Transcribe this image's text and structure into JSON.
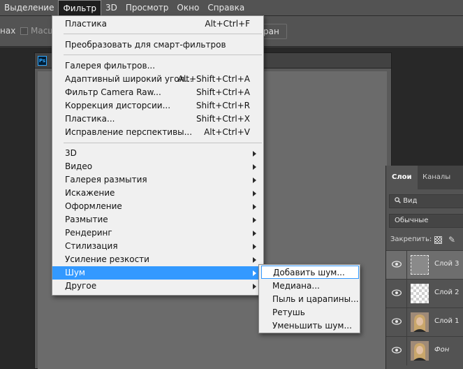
{
  "menubar": {
    "items": [
      "Выделение",
      "Фильтр",
      "3D",
      "Просмотр",
      "Окно",
      "Справка"
    ],
    "active": "Фильтр"
  },
  "optbar": {
    "partial_left": "нах",
    "checkbox_label": "Масш",
    "button_label": "ран"
  },
  "document": {
    "icon": "Ps"
  },
  "filter_menu": {
    "top": [
      {
        "label": "Пластика",
        "shortcut": "Alt+Ctrl+F"
      }
    ],
    "group1": [
      {
        "label": "Преобразовать для смарт-фильтров"
      }
    ],
    "group2": [
      {
        "label": "Галерея фильтров..."
      },
      {
        "label": "Адаптивный широкий угол...",
        "shortcut": "Alt+Shift+Ctrl+A"
      },
      {
        "label": "Фильтр Camera Raw...",
        "shortcut": "Shift+Ctrl+A"
      },
      {
        "label": "Коррекция дисторсии...",
        "shortcut": "Shift+Ctrl+R"
      },
      {
        "label": "Пластика...",
        "shortcut": "Shift+Ctrl+X"
      },
      {
        "label": "Исправление перспективы...",
        "shortcut": "Alt+Ctrl+V"
      }
    ],
    "group3": [
      {
        "label": "3D"
      },
      {
        "label": "Видео"
      },
      {
        "label": "Галерея размытия"
      },
      {
        "label": "Искажение"
      },
      {
        "label": "Оформление"
      },
      {
        "label": "Размытие"
      },
      {
        "label": "Рендеринг"
      },
      {
        "label": "Стилизация"
      },
      {
        "label": "Усиление резкости"
      },
      {
        "label": "Шум"
      },
      {
        "label": "Другое"
      }
    ],
    "highlighted": "Шум"
  },
  "noise_submenu": {
    "items": [
      "Добавить шум...",
      "Медиана...",
      "Пыль и царапины...",
      "Ретушь",
      "Уменьшить шум..."
    ],
    "highlighted": "Добавить шум..."
  },
  "layers_panel": {
    "tabs": [
      "Слои",
      "Каналы"
    ],
    "search_kind": "Вид",
    "blend_mode": "Обычные",
    "lock_label": "Закрепить:",
    "layers": [
      {
        "name": "Слой 3",
        "thumb": "gray",
        "selected": true
      },
      {
        "name": "Слой 2",
        "thumb": "transparent",
        "selected": false
      },
      {
        "name": "Слой 1",
        "thumb": "photo",
        "selected": false
      },
      {
        "name": "Фон",
        "thumb": "photo",
        "selected": false
      }
    ]
  },
  "colors": {
    "menu_highlight": "#3399ff",
    "panel_bg": "#535353",
    "workspace_bg": "#282828"
  }
}
